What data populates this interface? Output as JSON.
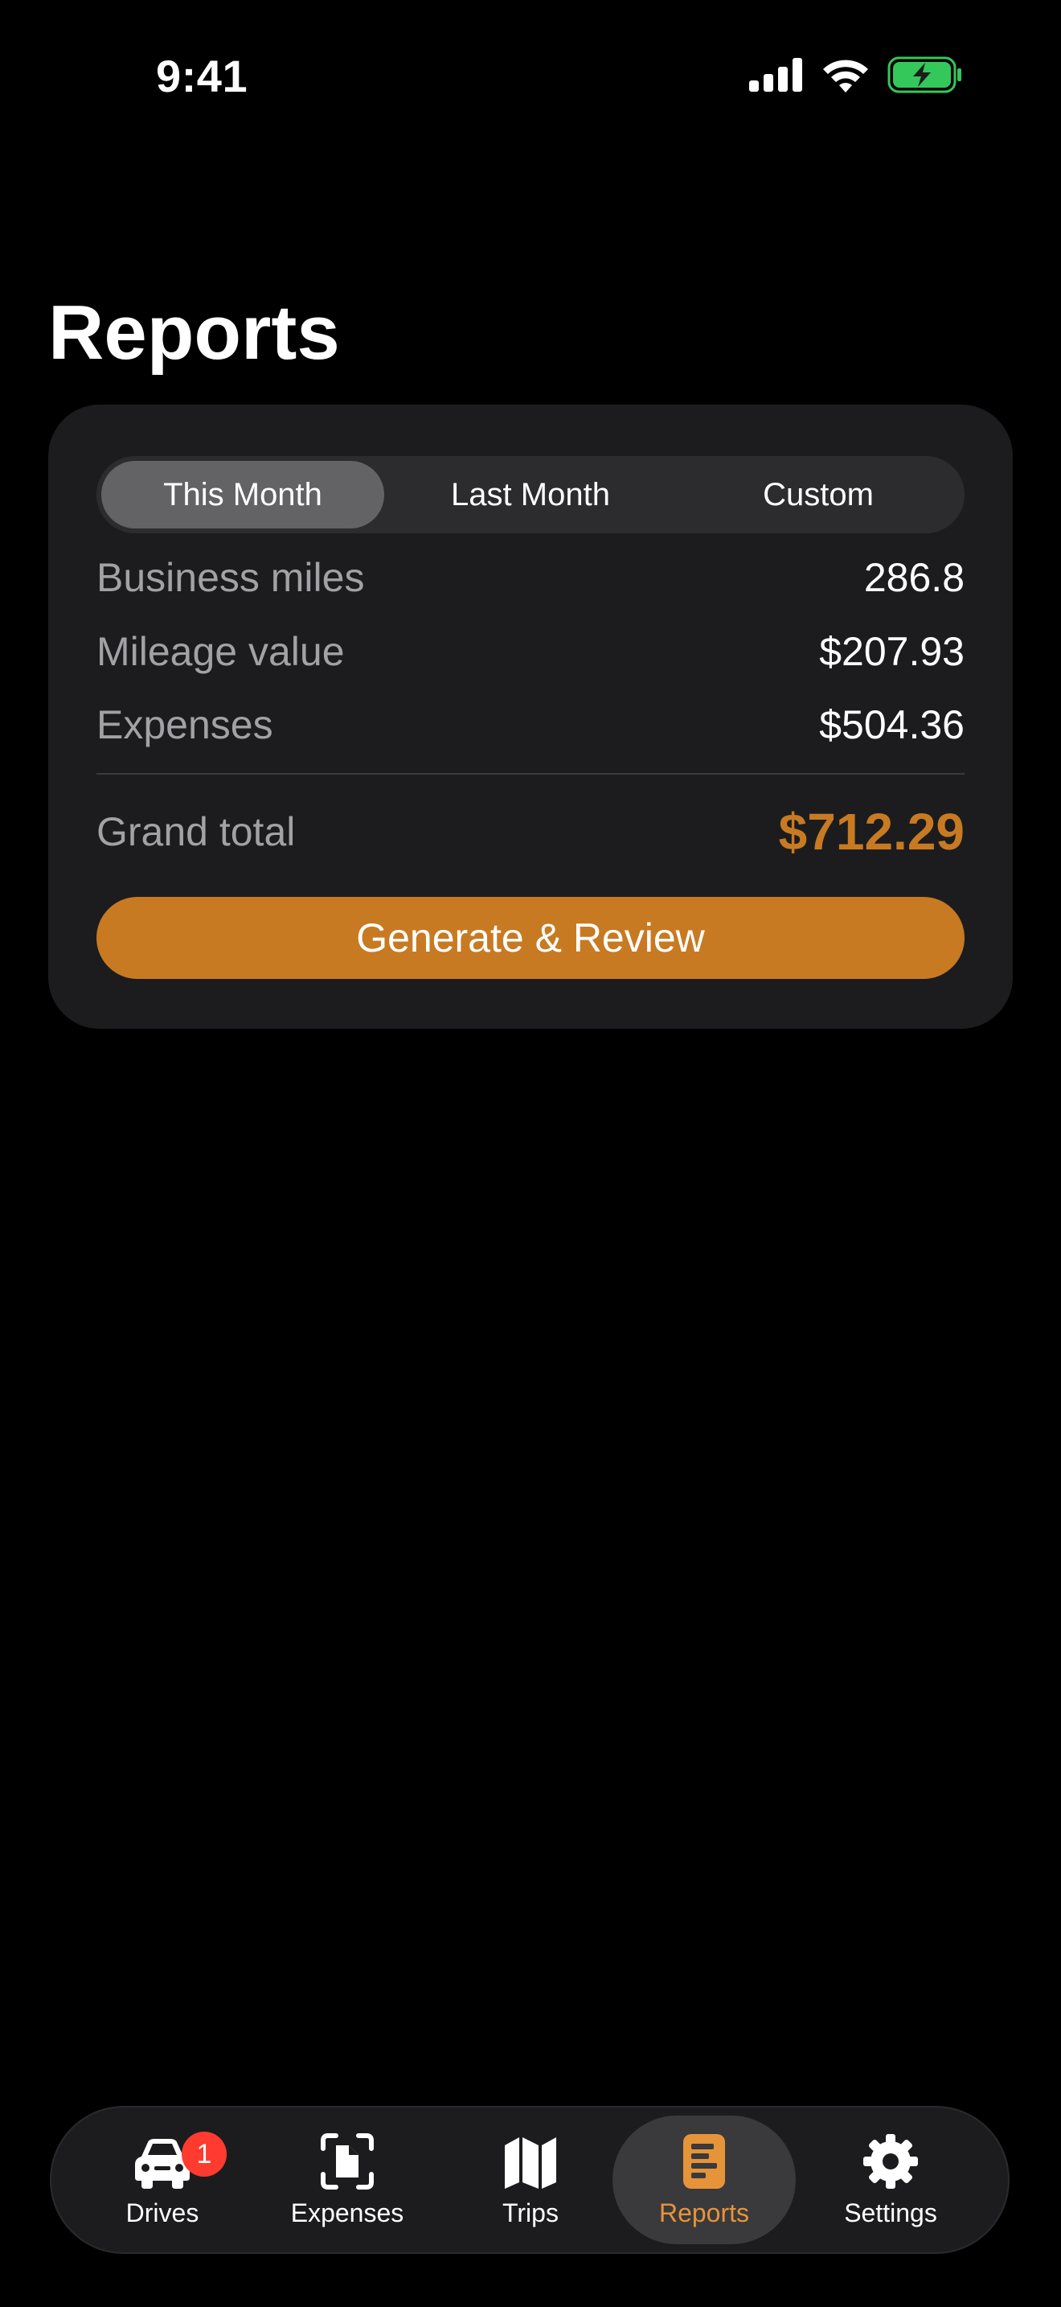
{
  "status_bar": {
    "time": "9:41"
  },
  "header": {
    "title": "Reports"
  },
  "period_selector": {
    "options": [
      "This Month",
      "Last Month",
      "Custom"
    ],
    "selected": "This Month"
  },
  "summary": {
    "business_miles_label": "Business miles",
    "business_miles_value": "286.8",
    "mileage_value_label": "Mileage value",
    "mileage_value_value": "$207.93",
    "expenses_label": "Expenses",
    "expenses_value": "$504.36",
    "grand_total_label": "Grand total",
    "grand_total_value": "$712.29"
  },
  "actions": {
    "generate_label": "Generate & Review"
  },
  "tab_bar": {
    "items": [
      {
        "label": "Drives",
        "icon": "car-icon",
        "badge": "1"
      },
      {
        "label": "Expenses",
        "icon": "receipt-scan-icon"
      },
      {
        "label": "Trips",
        "icon": "map-icon"
      },
      {
        "label": "Reports",
        "icon": "report-document-icon",
        "active": true
      },
      {
        "label": "Settings",
        "icon": "gear-icon"
      }
    ]
  },
  "colors": {
    "accent": "#c87a22",
    "active_tab": "#e6943a",
    "badge": "#ff3b30",
    "card": "#1c1c1e",
    "battery": "#34c759"
  }
}
